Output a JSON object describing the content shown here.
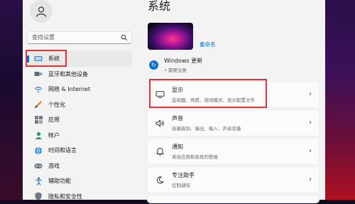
{
  "search": {
    "placeholder": "查找设置"
  },
  "sidebar": {
    "items": [
      {
        "label": "系统",
        "icon": "system-icon",
        "selected": true
      },
      {
        "label": "蓝牙和其他设备",
        "icon": "bluetooth-icon"
      },
      {
        "label": "网络 & Internet",
        "icon": "network-icon"
      },
      {
        "label": "个性化",
        "icon": "personalization-icon"
      },
      {
        "label": "应用",
        "icon": "apps-icon"
      },
      {
        "label": "帐户",
        "icon": "account-icon"
      },
      {
        "label": "时间和语言",
        "icon": "time-language-icon"
      },
      {
        "label": "游戏",
        "icon": "gaming-icon"
      },
      {
        "label": "辅助功能",
        "icon": "accessibility-icon"
      },
      {
        "label": "隐私和安全性",
        "icon": "privacy-icon"
      }
    ]
  },
  "main": {
    "title": "系统",
    "rename": "重命名",
    "windows_update": {
      "title": "Windows 更新",
      "subtitle": "需要注意"
    },
    "cards": [
      {
        "title": "显示",
        "subtitle": "监视器、亮度、夜间模式、显示配置文件",
        "icon": "display-icon"
      },
      {
        "title": "声音",
        "subtitle": "音量级别、输出、输入、声音设备",
        "icon": "sound-icon"
      },
      {
        "title": "通知",
        "subtitle": "来自应用和系统的警报",
        "icon": "notification-icon"
      },
      {
        "title": "专注助手",
        "subtitle": "控制通知",
        "icon": "focus-assist-icon"
      }
    ]
  },
  "colors": {
    "accent": "#0067c0",
    "highlight_box": "#e0303a"
  }
}
